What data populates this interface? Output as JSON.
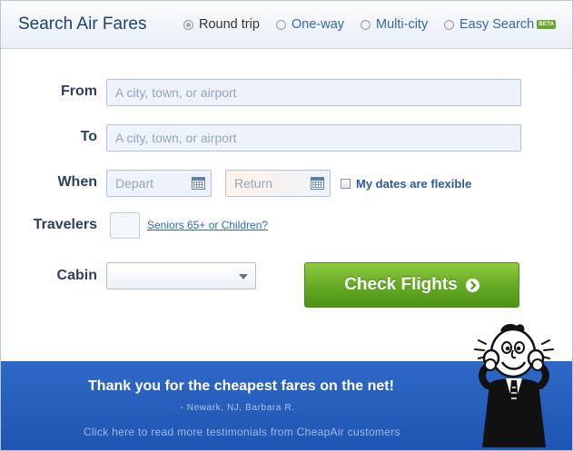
{
  "header": {
    "title": "Search Air Fares",
    "trip_types": [
      {
        "label": "Round trip",
        "selected": true
      },
      {
        "label": "One-way",
        "selected": false
      },
      {
        "label": "Multi-city",
        "selected": false
      },
      {
        "label": "Easy Search",
        "selected": false,
        "badge": "BETA"
      }
    ]
  },
  "form": {
    "from_label": "From",
    "from_placeholder": "A city, town, or airport",
    "to_label": "To",
    "to_placeholder": "A city, town, or airport",
    "when_label": "When",
    "depart_placeholder": "Depart",
    "return_placeholder": "Return",
    "flexible_label": "My dates are flexible",
    "flexible_checked": false,
    "travelers_label": "Travelers",
    "travelers_value": "",
    "seniors_link": "Seniors 65+ or Children?",
    "cabin_label": "Cabin",
    "cabin_value": "",
    "submit_label": "Check Flights"
  },
  "testimonial": {
    "quote": "Thank you for the cheapest fares on the net!",
    "author": "- Newark, NJ, Barbara R.",
    "more_link": "Click here to read more testimonials from CheapAir customers"
  },
  "colors": {
    "header_title": "#1f3f7c",
    "link": "#2d68b8",
    "button_green": "#63a823",
    "banner_blue": "#2a62c0"
  },
  "icons": [
    "radio-icon",
    "calendar-icon",
    "dropdown-arrow-icon",
    "arrow-right-circle-icon",
    "mascot-illustration"
  ]
}
